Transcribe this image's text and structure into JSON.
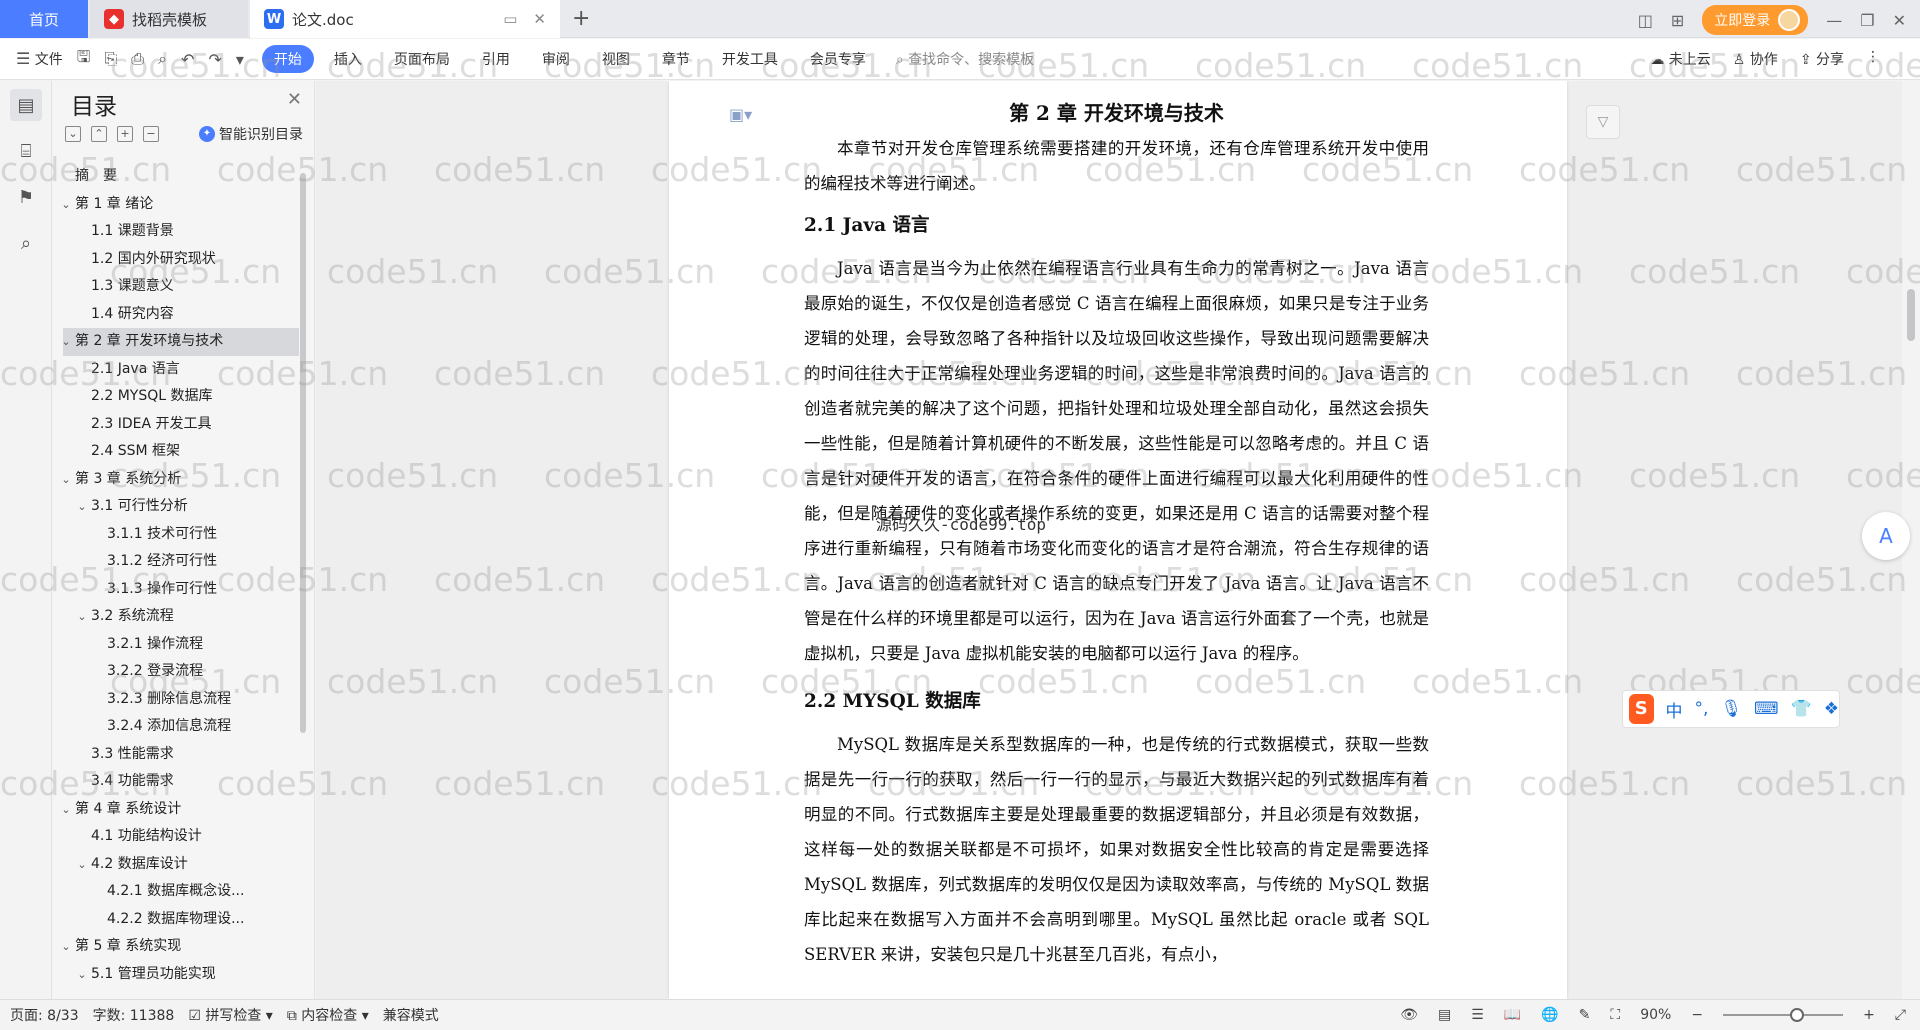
{
  "tabs": {
    "home": "首页",
    "template": "找稻壳模板",
    "document": "论文.doc"
  },
  "titlebar": {
    "login": "立即登录"
  },
  "ribbon": {
    "file": "文件",
    "tabs": [
      "开始",
      "插入",
      "页面布局",
      "引用",
      "审阅",
      "视图",
      "章节",
      "开发工具",
      "会员专享"
    ],
    "search_placeholder": "查找命令、搜索模板",
    "cloud": "未上云",
    "collab": "协作",
    "share": "分享"
  },
  "toc": {
    "title": "目录",
    "smart": "智能识别目录",
    "items": [
      {
        "label": "摘　要",
        "level": 1,
        "arrow": ""
      },
      {
        "label": "第 1 章  绪论",
        "level": 1,
        "arrow": "v"
      },
      {
        "label": "1.1  课题背景",
        "level": 2,
        "arrow": ""
      },
      {
        "label": "1.2  国内外研究现状",
        "level": 2,
        "arrow": ""
      },
      {
        "label": "1.3  课题意义",
        "level": 2,
        "arrow": ""
      },
      {
        "label": "1.4  研究内容",
        "level": 2,
        "arrow": ""
      },
      {
        "label": "第 2 章  开发环境与技术",
        "level": 1,
        "arrow": "v",
        "active": true
      },
      {
        "label": "2.1 Java 语言",
        "level": 2,
        "arrow": ""
      },
      {
        "label": "2.2 MYSQL 数据库",
        "level": 2,
        "arrow": ""
      },
      {
        "label": "2.3 IDEA 开发工具",
        "level": 2,
        "arrow": ""
      },
      {
        "label": "2.4 SSM 框架",
        "level": 2,
        "arrow": ""
      },
      {
        "label": "第 3 章  系统分析",
        "level": 1,
        "arrow": "v"
      },
      {
        "label": "3.1  可行性分析",
        "level": 2,
        "arrow": "v"
      },
      {
        "label": "3.1.1  技术可行性",
        "level": 3,
        "arrow": ""
      },
      {
        "label": "3.1.2  经济可行性",
        "level": 3,
        "arrow": ""
      },
      {
        "label": "3.1.3  操作可行性",
        "level": 3,
        "arrow": ""
      },
      {
        "label": "3.2  系统流程",
        "level": 2,
        "arrow": "v"
      },
      {
        "label": "3.2.1  操作流程",
        "level": 3,
        "arrow": ""
      },
      {
        "label": "3.2.2  登录流程",
        "level": 3,
        "arrow": ""
      },
      {
        "label": "3.2.3  删除信息流程",
        "level": 3,
        "arrow": ""
      },
      {
        "label": "3.2.4  添加信息流程",
        "level": 3,
        "arrow": ""
      },
      {
        "label": "3.3  性能需求",
        "level": 2,
        "arrow": ""
      },
      {
        "label": "3.4  功能需求",
        "level": 2,
        "arrow": ""
      },
      {
        "label": "第 4 章  系统设计",
        "level": 1,
        "arrow": "v"
      },
      {
        "label": "4.1  功能结构设计",
        "level": 2,
        "arrow": ""
      },
      {
        "label": "4.2  数据库设计",
        "level": 2,
        "arrow": "v"
      },
      {
        "label": "4.2.1  数据库概念设...",
        "level": 3,
        "arrow": ""
      },
      {
        "label": "4.2.2  数据库物理设...",
        "level": 3,
        "arrow": ""
      },
      {
        "label": "第 5 章  系统实现",
        "level": 1,
        "arrow": "v"
      },
      {
        "label": "5.1  管理员功能实现",
        "level": 2,
        "arrow": "v"
      }
    ]
  },
  "document": {
    "chapter": "第 2 章  开发环境与技术",
    "intro": "本章节对开发仓库管理系统需要搭建的开发环境，还有仓库管理系统开发中使用的编程技术等进行阐述。",
    "s1_title": "2.1 Java 语言",
    "s1_body": "Java 语言是当今为止依然在编程语言行业具有生命力的常青树之一。Java 语言最原始的诞生，不仅仅是创造者感觉 C 语言在编程上面很麻烦，如果只是专注于业务逻辑的处理，会导致忽略了各种指针以及垃圾回收这些操作，导致出现问题需要解决的时间往往大于正常编程处理业务逻辑的时间，这些是非常浪费时间的。Java 语言的创造者就完美的解决了这个问题，把指针处理和垃圾处理全部自动化，虽然这会损失一些性能，但是随着计算机硬件的不断发展，这些性能是可以忽略考虑的。并且 C 语言是针对硬件开发的语言，在符合条件的硬件上面进行编程可以最大化利用硬件的性能，但是随着硬件的变化或者操作系统的变更，如果还是用 C 语言的话需要对整个程序进行重新编程，只有随着市场变化而变化的语言才是符合潮流，符合生存规律的语言。Java 语言的创造者就针对 C 语言的缺点专门开发了 Java 语言。让 Java 语言不管是在什么样的环境里都是可以运行，因为在 Java 语言运行外面套了一个壳，也就是虚拟机，只要是 Java 虚拟机能安装的电脑都可以运行 Java 的程序。",
    "s2_title": "2.2 MYSQL 数据库",
    "s2_body": "MySQL 数据库是关系型数据库的一种，也是传统的行式数据模式，获取一些数据是先一行一行的获取，然后一行一行的显示，与最近大数据兴起的列式数据库有着明显的不同。行式数据库主要是处理最重要的数据逻辑部分，并且必须是有效数据，这样每一处的数据关联都是不可损坏，如果对数据安全性比较高的肯定是需要选择 MySQL 数据库，列式数据库的发明仅仅是因为读取效率高，与传统的 MySQL 数据库比起来在数据写入方面并不会高明到哪里。MySQL 虽然比起 oracle 或者 SQL SERVER 来讲，安装包只是几十兆甚至几百兆，有点小，",
    "overlay": "源码久久-code99.top"
  },
  "watermark": "code51.cn",
  "ime": {
    "label": "中"
  },
  "status": {
    "page": "页面: 8/33",
    "words": "字数: 11388",
    "spell": "拼写检查",
    "content": "内容检查",
    "compat": "兼容模式",
    "zoom": "90%",
    "zoom_level": 0.62
  }
}
